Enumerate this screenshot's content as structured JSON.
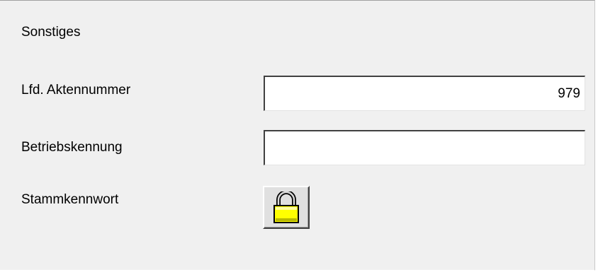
{
  "section": {
    "title": "Sonstiges"
  },
  "fields": [
    {
      "label": "Lfd. Aktennummer",
      "value": "979"
    },
    {
      "label": "Betriebskennung",
      "value": ""
    }
  ],
  "password": {
    "label": "Stammkennwort",
    "icon": "lock-icon"
  },
  "colors": {
    "panel_bg": "#f0f0f0",
    "lock_yellow": "#ffff00"
  }
}
